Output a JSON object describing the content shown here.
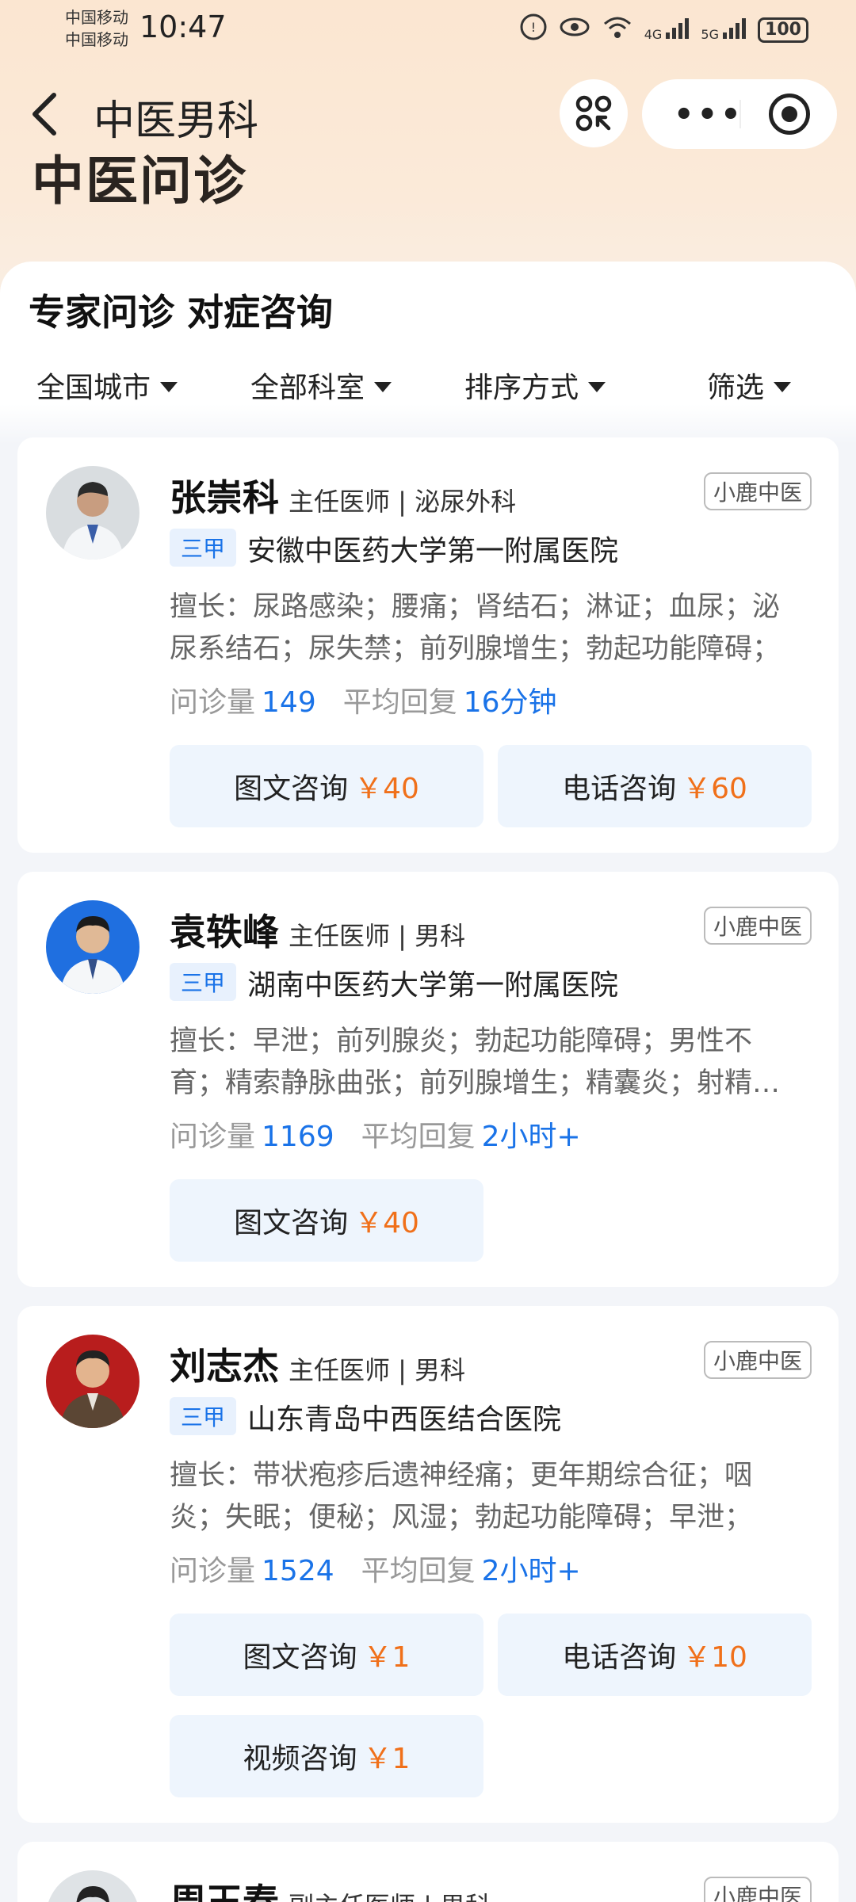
{
  "status_bar": {
    "carrier_1": "中国移动",
    "carrier_2": "中国移动",
    "time": "10:47",
    "network_1": "4G",
    "network_2": "5G",
    "battery": "100"
  },
  "header": {
    "nav_title": "中医男科",
    "page_title": "中医问诊"
  },
  "section": {
    "title": "专家问诊 对症咨询",
    "filters": [
      "全国城市",
      "全部科室",
      "排序方式",
      "筛选"
    ]
  },
  "doctors": [
    {
      "name": "张崇科",
      "title": "主任医师 | 泌尿外科",
      "source": "小鹿中医",
      "grade": "三甲",
      "hospital": "安徽中医药大学第一附属医院",
      "expertise": "擅长：尿路感染；腰痛；肾结石；淋证；血尿；泌尿系结石；尿失禁；前列腺增生；勃起功能障碍；",
      "stats_label_1": "问诊量",
      "consults": "149",
      "stats_label_2": "平均回复",
      "reply": "16分钟",
      "services": [
        {
          "label": "图文咨询",
          "price": "￥40"
        },
        {
          "label": "电话咨询",
          "price": "￥60"
        }
      ]
    },
    {
      "name": "袁轶峰",
      "title": "主任医师 | 男科",
      "source": "小鹿中医",
      "grade": "三甲",
      "hospital": "湖南中医药大学第一附属医院",
      "expertise": "擅长：早泄；前列腺炎；勃起功能障碍；男性不育；精索静脉曲张；前列腺增生；精囊炎；射精障碍；",
      "stats_label_1": "问诊量",
      "consults": "1169",
      "stats_label_2": "平均回复",
      "reply": "2小时+",
      "services": [
        {
          "label": "图文咨询",
          "price": "￥40"
        }
      ]
    },
    {
      "name": "刘志杰",
      "title": "主任医师 | 男科",
      "source": "小鹿中医",
      "grade": "三甲",
      "hospital": "山东青岛中西医结合医院",
      "expertise": "擅长：带状疱疹后遗神经痛；更年期综合征；咽炎；失眠；便秘；风湿；勃起功能障碍；早泄；",
      "stats_label_1": "问诊量",
      "consults": "1524",
      "stats_label_2": "平均回复",
      "reply": "2小时+",
      "services": [
        {
          "label": "图文咨询",
          "price": "￥1"
        },
        {
          "label": "电话咨询",
          "price": "￥10"
        },
        {
          "label": "视频咨询",
          "price": "￥1"
        }
      ]
    },
    {
      "name": "周玉春",
      "title": "副主任医师 | 男科",
      "source": "小鹿中医"
    }
  ]
}
